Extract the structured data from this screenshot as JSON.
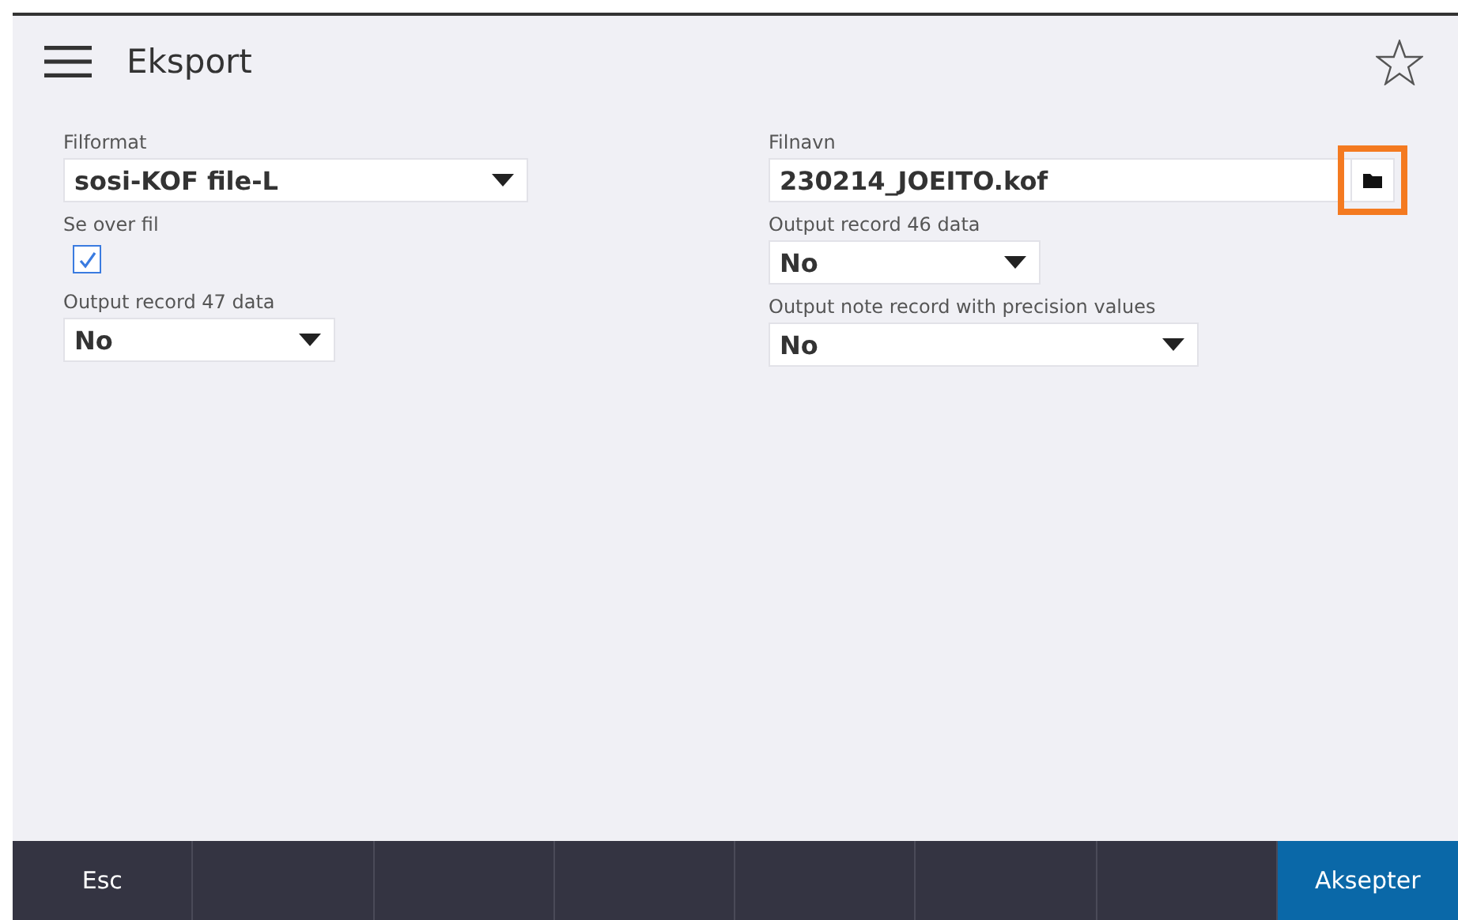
{
  "header": {
    "title": "Eksport"
  },
  "left_fields": [
    {
      "kind": "dropdown",
      "label": "Filformat",
      "value": "sosi-KOF file-L"
    },
    {
      "kind": "checkbox",
      "label": "Se over fil",
      "checked": true
    },
    {
      "kind": "dropdown",
      "label": "Output record 47 data",
      "value": "No"
    }
  ],
  "right_fields": [
    {
      "kind": "file",
      "label": "Filnavn",
      "value": "230214_JOEITO.kof",
      "highlighted": true
    },
    {
      "kind": "dropdown",
      "label": "Output record 46 data",
      "value": "No"
    },
    {
      "kind": "dropdown",
      "label": "Output note record with precision values",
      "value": "No"
    }
  ],
  "footer": [
    {
      "kind": "plain",
      "label": "Esc"
    },
    {
      "kind": "blank"
    },
    {
      "kind": "blank"
    },
    {
      "kind": "blank"
    },
    {
      "kind": "blank"
    },
    {
      "kind": "blank"
    },
    {
      "kind": "blank"
    },
    {
      "kind": "primary",
      "label": "Aksepter"
    }
  ]
}
